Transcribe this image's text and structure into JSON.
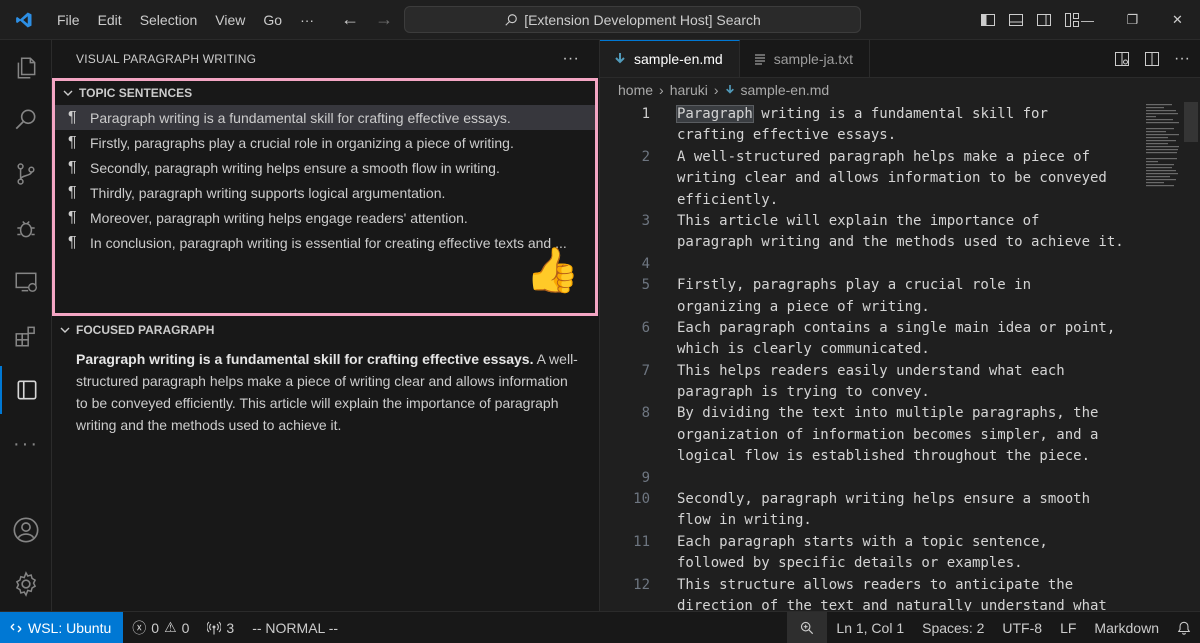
{
  "titlebar": {
    "menu": [
      "File",
      "Edit",
      "Selection",
      "View",
      "Go",
      "···"
    ],
    "search_text": "[Extension Development Host] Search"
  },
  "activitybar": {
    "icons": [
      "explorer-icon",
      "search-icon",
      "source-control-icon",
      "run-debug-icon",
      "remote-explorer-icon",
      "extensions-icon",
      "visual-paragraph-icon",
      "more-icon",
      "account-icon",
      "settings-gear-icon"
    ]
  },
  "sidebar": {
    "title": "VISUAL PARAGRAPH WRITING",
    "more": "···",
    "topic_section": {
      "title": "TOPIC SENTENCES",
      "items": [
        "Paragraph writing is a fundamental skill for crafting effective essays.",
        "Firstly, paragraphs play a crucial role in organizing a piece of writing.",
        "Secondly, paragraph writing helps ensure a smooth flow in writing.",
        "Thirdly, paragraph writing supports logical argumentation.",
        "Moreover, paragraph writing helps engage readers' attention.",
        "In conclusion, paragraph writing is essential for creating effective texts and ..."
      ],
      "emoji": "👍"
    },
    "focused_section": {
      "title": "FOCUSED PARAGRAPH",
      "bold": "Paragraph writing is a fundamental skill for crafting effective essays.",
      "rest": " A well-structured paragraph helps make a piece of writing clear and allows information to be conveyed efficiently. This article will explain the importance of paragraph writing and the methods used to achieve it."
    }
  },
  "editor": {
    "tabs": [
      {
        "label": "sample-en.md",
        "active": true
      },
      {
        "label": "sample-ja.txt",
        "active": false
      }
    ],
    "breadcrumb": [
      "home",
      "haruki",
      "sample-en.md"
    ],
    "lines": [
      {
        "n": "1",
        "t": "writing is a fundamental skill for",
        "first_word": "Paragraph"
      },
      {
        "n": "",
        "t": "crafting effective essays."
      },
      {
        "n": "2",
        "t": "A well-structured paragraph helps make a piece of"
      },
      {
        "n": "",
        "t": "writing clear and allows information to be conveyed"
      },
      {
        "n": "",
        "t": "efficiently."
      },
      {
        "n": "3",
        "t": "This article will explain the importance of"
      },
      {
        "n": "",
        "t": "paragraph writing and the methods used to achieve it."
      },
      {
        "n": "4",
        "t": ""
      },
      {
        "n": "5",
        "t": "Firstly, paragraphs play a crucial role in"
      },
      {
        "n": "",
        "t": "organizing a piece of writing."
      },
      {
        "n": "6",
        "t": "Each paragraph contains a single main idea or point,"
      },
      {
        "n": "",
        "t": "which is clearly communicated."
      },
      {
        "n": "7",
        "t": "This helps readers easily understand what each"
      },
      {
        "n": "",
        "t": "paragraph is trying to convey."
      },
      {
        "n": "8",
        "t": "By dividing the text into multiple paragraphs, the"
      },
      {
        "n": "",
        "t": "organization of information becomes simpler, and a"
      },
      {
        "n": "",
        "t": "logical flow is established throughout the piece."
      },
      {
        "n": "9",
        "t": ""
      },
      {
        "n": "10",
        "t": "Secondly, paragraph writing helps ensure a smooth"
      },
      {
        "n": "",
        "t": "flow in writing."
      },
      {
        "n": "11",
        "t": "Each paragraph starts with a topic sentence,"
      },
      {
        "n": "",
        "t": "followed by specific details or examples."
      },
      {
        "n": "12",
        "t": "This structure allows readers to anticipate the"
      },
      {
        "n": "",
        "t": "direction of the text and naturally understand what"
      }
    ]
  },
  "statusbar": {
    "remote": "WSL: Ubuntu",
    "errors": "0",
    "warnings": "0",
    "ports": "3",
    "mode": "-- NORMAL --",
    "position": "Ln 1, Col 1",
    "spaces": "Spaces: 2",
    "encoding": "UTF-8",
    "eol": "LF",
    "language": "Markdown"
  },
  "colors": {
    "accent": "#0078d4",
    "highlight_border": "#f4a6c4"
  }
}
